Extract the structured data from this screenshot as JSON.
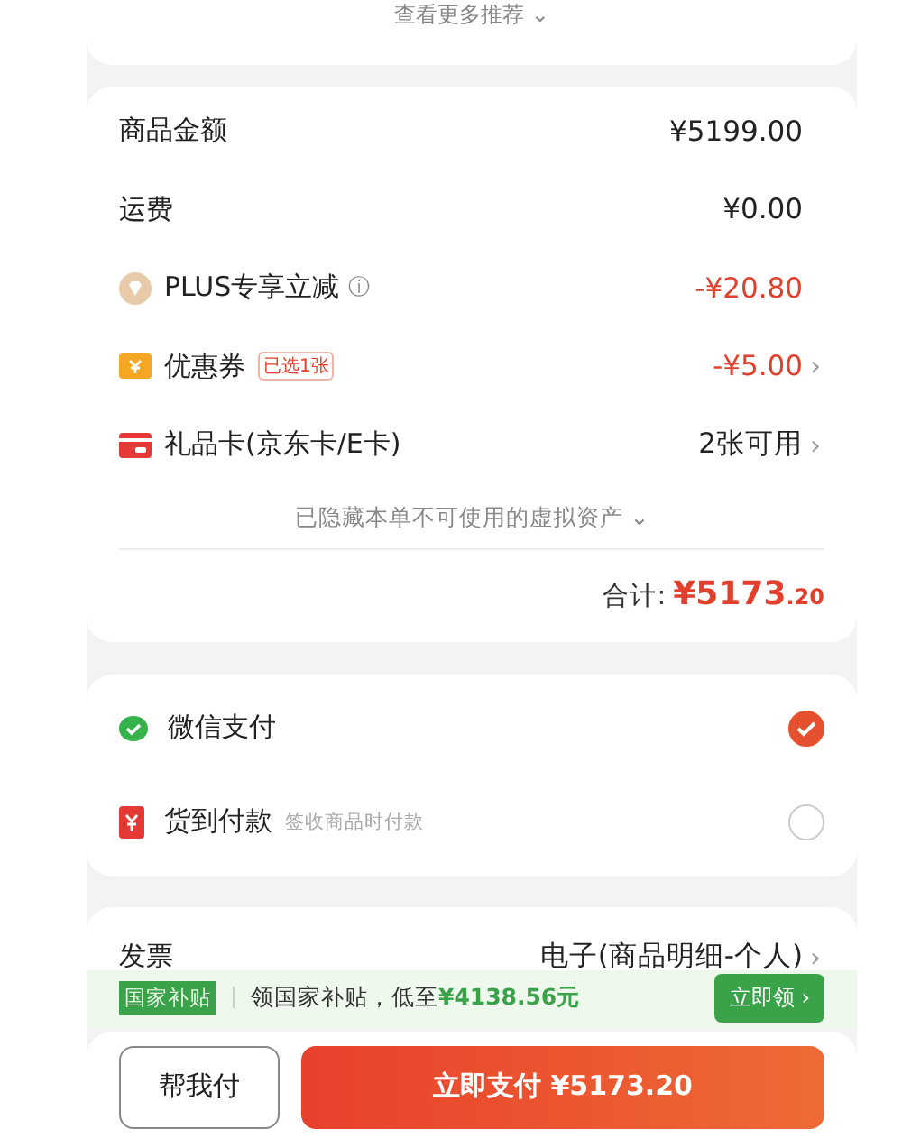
{
  "recommend_link": {
    "label": "查看更多推荐",
    "chevron": "⌄"
  },
  "summary": {
    "rows": [
      {
        "label": "商品金额",
        "value": "¥5199.00",
        "kind": "amount"
      },
      {
        "label": "运费",
        "value": "¥0.00",
        "kind": "amount"
      },
      {
        "label": "PLUS专享立减",
        "value": "-¥20.80",
        "kind": "member_discount",
        "info": "ⓘ"
      },
      {
        "label": "优惠券",
        "value": "-¥5.00",
        "kind": "coupon",
        "tag": "已选1张",
        "chevron": "›"
      },
      {
        "label": "礼品卡(京东卡/E卡)",
        "value": "2张可用",
        "kind": "gift_card",
        "chevron": "›"
      }
    ],
    "hidden_note": {
      "label": "已隐藏本单不可使用的虚拟资产",
      "chevron": "⌄"
    },
    "total": {
      "label": "合计:",
      "amount": "¥5173",
      "cents": ".20"
    }
  },
  "payment_methods": [
    {
      "name": "微信支付",
      "kind": "wallet",
      "selected": true
    },
    {
      "name": "货到付款",
      "kind": "cash_on_delivery",
      "hint": "签收商品时付款",
      "selected": false
    }
  ],
  "invoice": {
    "label": "发票",
    "value": "电子(商品明细-个人)",
    "chevron": "›"
  },
  "subsidy": {
    "tag": "国家补贴",
    "text": "领国家补贴，低至",
    "price": "¥4138.56元",
    "button": "立即领 ›"
  },
  "actions": {
    "secondary": "帮我付",
    "primary": "立即支付 ¥5173.20"
  }
}
